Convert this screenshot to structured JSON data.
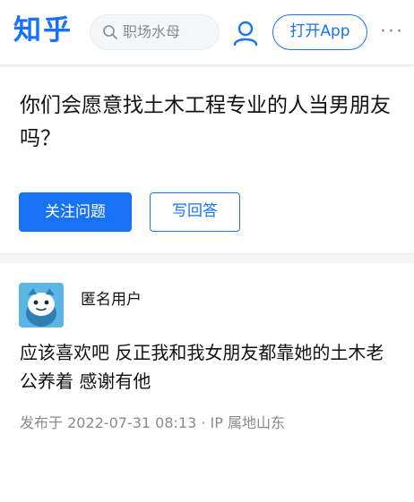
{
  "header": {
    "logo": "知乎",
    "search_placeholder": "职场水母",
    "open_app_label": "打开App",
    "more_label": "···"
  },
  "question": {
    "title": "你们会愿意找土木工程专业的人当男朋友吗？",
    "follow_label": "关注问题",
    "answer_label": "写回答"
  },
  "answer": {
    "author": "匿名用户",
    "content": "应该喜欢吧 反正我和我女朋友都靠她的土木老公养着 感谢有他",
    "meta": "发布于 2022-07-31 08:13 · IP 属地山东"
  },
  "colors": {
    "brand": "#1772f6",
    "muted": "#8a8a8a",
    "avatar_bg": "#5bb6e6"
  }
}
